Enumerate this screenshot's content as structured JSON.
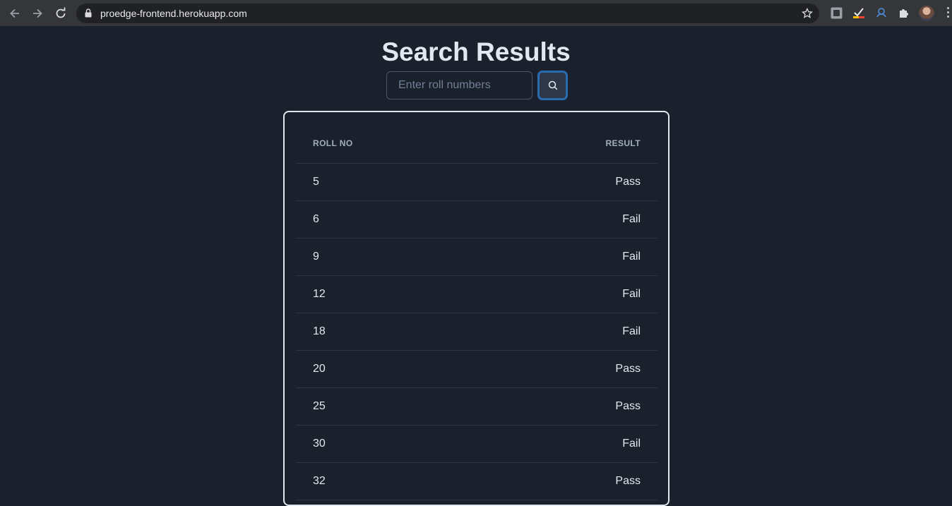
{
  "browser": {
    "url": "proedge-frontend.herokuapp.com"
  },
  "page": {
    "title": "Search Results"
  },
  "search": {
    "placeholder": "Enter roll numbers",
    "value": ""
  },
  "table": {
    "headers": [
      "ROLL NO",
      "RESULT"
    ],
    "rows": [
      {
        "roll": "5",
        "result": "Pass"
      },
      {
        "roll": "6",
        "result": "Fail"
      },
      {
        "roll": "9",
        "result": "Fail"
      },
      {
        "roll": "12",
        "result": "Fail"
      },
      {
        "roll": "18",
        "result": "Fail"
      },
      {
        "roll": "20",
        "result": "Pass"
      },
      {
        "roll": "25",
        "result": "Pass"
      },
      {
        "roll": "30",
        "result": "Fail"
      },
      {
        "roll": "32",
        "result": "Pass"
      }
    ]
  },
  "colors": {
    "background": "#1a202c",
    "title": "#e2e8f0",
    "accent": "#2b6cb0"
  }
}
